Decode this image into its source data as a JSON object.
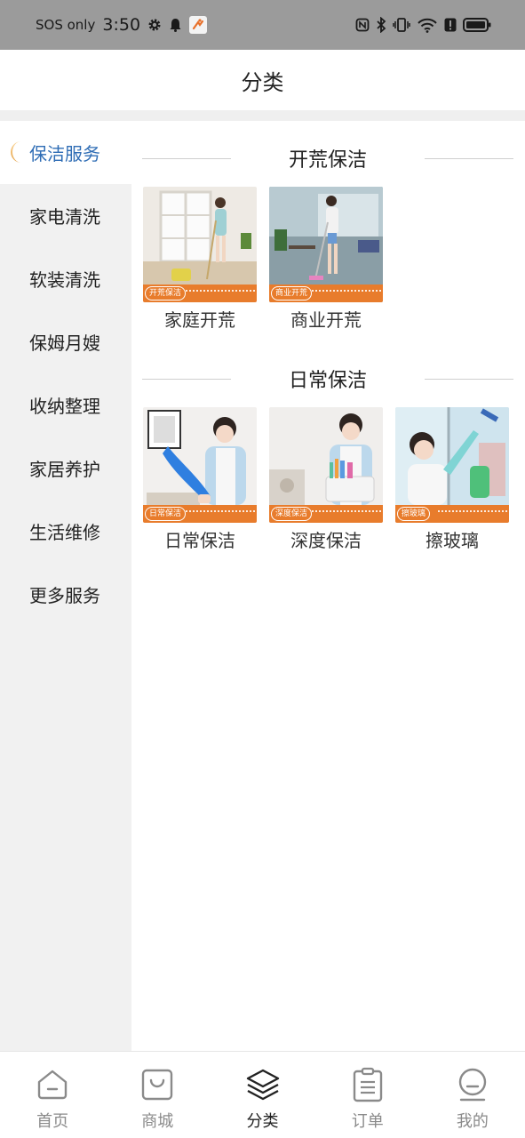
{
  "status_bar": {
    "carrier": "SOS only",
    "time": "3:50",
    "icons": [
      "gear-icon",
      "bell-icon",
      "app-notification-icon",
      "nfc-icon",
      "bluetooth-icon",
      "vibrate-icon",
      "wifi-icon",
      "alert-icon",
      "battery-icon"
    ]
  },
  "header": {
    "title": "分类"
  },
  "sidebar": {
    "items": [
      {
        "label": "保洁服务",
        "active": true
      },
      {
        "label": "家电清洗"
      },
      {
        "label": "软装清洗"
      },
      {
        "label": "保姆月嫂"
      },
      {
        "label": "收纳整理"
      },
      {
        "label": "家居养护"
      },
      {
        "label": "生活维修"
      },
      {
        "label": "更多服务"
      }
    ]
  },
  "content": {
    "sections": [
      {
        "title": "开荒保洁",
        "tiles": [
          {
            "label": "家庭开荒",
            "tag": "开荒保洁"
          },
          {
            "label": "商业开荒",
            "tag": "商业开荒"
          }
        ]
      },
      {
        "title": "日常保洁",
        "tiles": [
          {
            "label": "日常保洁",
            "tag": "日常保洁"
          },
          {
            "label": "深度保洁",
            "tag": "深度保洁"
          },
          {
            "label": "擦玻璃",
            "tag": "擦玻璃"
          }
        ]
      }
    ]
  },
  "bottom_nav": {
    "items": [
      {
        "label": "首页",
        "icon": "home-icon"
      },
      {
        "label": "商城",
        "icon": "shopping-bag-icon"
      },
      {
        "label": "分类",
        "icon": "layers-icon",
        "active": true
      },
      {
        "label": "订单",
        "icon": "clipboard-icon"
      },
      {
        "label": "我的",
        "icon": "user-icon"
      }
    ]
  },
  "colors": {
    "accent": "#2f6db5",
    "banner": "#e87c2c",
    "status_bar": "#9b9b9b",
    "sidebar_bg": "#f1f1f1"
  }
}
